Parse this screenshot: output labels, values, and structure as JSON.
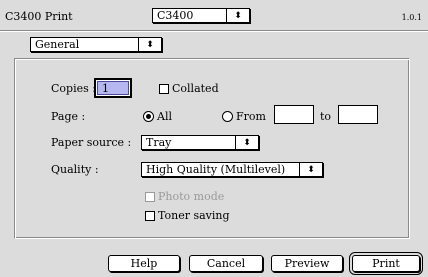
{
  "window": {
    "title": "C3400 Print",
    "version": "1.0.1"
  },
  "printer_select": {
    "value": "C3400"
  },
  "panel_select": {
    "value": "General"
  },
  "copies": {
    "label": "Copies :",
    "value": "1",
    "collated_label": "Collated",
    "collated_checked": false
  },
  "page": {
    "label": "Page :",
    "all_label": "All",
    "from_label": "From",
    "to_label": "to",
    "from_value": "",
    "to_value": "",
    "selected": "All"
  },
  "paper_source": {
    "label": "Paper source :",
    "value": "Tray"
  },
  "quality": {
    "label": "Quality :",
    "value": "High Quality (Multilevel)"
  },
  "options": {
    "photo_mode_label": "Photo mode",
    "photo_mode_enabled": false,
    "toner_saving_label": "Toner saving",
    "toner_saving_checked": false
  },
  "buttons": {
    "help": "Help",
    "cancel": "Cancel",
    "preview": "Preview",
    "print": "Print"
  },
  "icons": {
    "popup_arrow": "up-down-arrows-icon",
    "arrow_glyph": "⬍"
  }
}
